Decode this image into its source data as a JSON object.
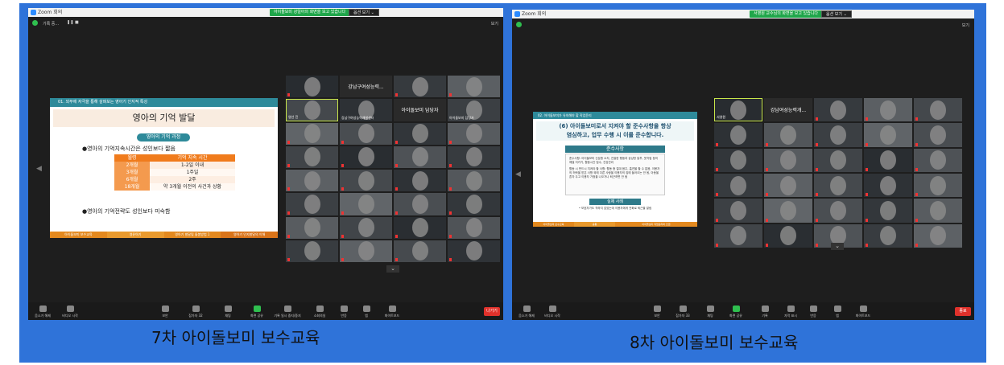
{
  "left": {
    "app_title": "Zoom 회의",
    "banner": "아이돌보미 강일아의 화면을 보고 있습니다",
    "view_options": "옵션 보기 ⌄",
    "recording": "기록 중...",
    "top_right": "보기",
    "slide": {
      "header": "01. 외부에 자극을 통해 살펴보는 영아기 인지적 특성",
      "title": "영아의 기억 발달",
      "pill": "영아의 기억 과정",
      "bullet1": "●영아의 기억지속시간은 성인보다 짧음",
      "table_headers": [
        "월령",
        "기억 지속 시간"
      ],
      "table_rows": [
        [
          "2개월",
          "1-2일 이내"
        ],
        [
          "3개월",
          "1주일"
        ],
        [
          "6개월",
          "2주"
        ],
        [
          "18개월",
          "약 3개월 이전의 사건과 상황"
        ]
      ],
      "bullet2": "●영아의 기억전략도 성인보다 미숙함",
      "footer": [
        "아이돌보미 보수교육",
        "영유아기",
        "영아기 발달및 돌봄방법 1",
        "영아기 인지발달의 이해"
      ]
    },
    "tiles": [
      {
        "type": "video"
      },
      {
        "type": "named",
        "label": "강남구여성능력..."
      },
      {
        "type": "video"
      },
      {
        "type": "video"
      },
      {
        "type": "video",
        "name": "영선 진",
        "speaker": true
      },
      {
        "type": "video",
        "name": "강남구여성능력개발센터"
      },
      {
        "type": "named",
        "label": "아이돌보미 담당자"
      },
      {
        "type": "video",
        "name": "아이돌보미 담당자"
      },
      {
        "type": "video"
      },
      {
        "type": "video"
      },
      {
        "type": "video"
      },
      {
        "type": "video"
      },
      {
        "type": "video"
      },
      {
        "type": "video"
      },
      {
        "type": "video"
      },
      {
        "type": "video"
      },
      {
        "type": "video"
      },
      {
        "type": "video"
      },
      {
        "type": "video"
      },
      {
        "type": "video"
      },
      {
        "type": "video"
      },
      {
        "type": "video"
      },
      {
        "type": "video"
      },
      {
        "type": "video"
      },
      {
        "type": "video"
      },
      {
        "type": "video"
      },
      {
        "type": "video"
      },
      {
        "type": "video"
      },
      {
        "type": "video"
      },
      {
        "type": "video"
      },
      {
        "type": "video"
      },
      {
        "type": "video"
      }
    ],
    "toolbar": [
      {
        "label": "음소거 해제",
        "x": 0
      },
      {
        "label": "비디오 시작",
        "x": 0
      },
      {
        "label": "보안",
        "x": 0
      },
      {
        "label": "참가자 32",
        "x": 0
      },
      {
        "label": "채팅",
        "x": 0
      },
      {
        "label": "화면 공유",
        "x": 0
      },
      {
        "label": "기록 일시 중지/중지",
        "x": 0
      },
      {
        "label": "소회의실",
        "x": 0
      },
      {
        "label": "반응",
        "x": 0
      },
      {
        "label": "앱",
        "x": 0
      },
      {
        "label": "화이트보드",
        "x": 0
      }
    ],
    "end_label": "나가기",
    "caption": "7차 아이돌보미 보수교육"
  },
  "right": {
    "app_title": "Zoom 회의",
    "banner": "서영원 교수님의 화면을 보고 있습니다",
    "view_options": "옵션 보기 ⌄",
    "top_right": "보기",
    "slide": {
      "header": "02. 아이돌보미가 유의해야 할 직업윤리",
      "title_line1": "(6) 아이돌보미로서 지켜야 할 준수사항을 항상",
      "title_line2": "염심하고, 업무 수행 시 이를 준수합니다.",
      "box_title": "준수사항",
      "para1": "준수사항: 아이돌보미 신분증 소지, 친절한 행동과 상냥한 말투, 옷차림 등의 예절 지키기, 활동시간 엄수, 건강관리",
      "para2": "활동 시 반드시 지켜야 할 사항: 활동 중 절대 음주, 흡연을 할 수 없음, 이용자의 허락을 받은 사항 외에 다른 사람을 이용자의 집에 들어오는 안 됨, 아동을 혼자 두고 이용자 가정을 나오거나 퇴근하면 안 됨",
      "case_title": "실제 사례",
      "case_text": "• 보호자가도 착하지 않았는데 이용자에게 전화로 퇴근을 알림",
      "footer": [
        "아이돌보미 보수교육",
        "공통",
        "아이돌보미 직업윤리와 인권"
      ]
    },
    "tiles": [
      {
        "type": "video",
        "name": "서영원",
        "speaker": true
      },
      {
        "type": "named",
        "label": "강남여성능력개..."
      },
      {
        "type": "video"
      },
      {
        "type": "video"
      },
      {
        "type": "video"
      },
      {
        "type": "video"
      },
      {
        "type": "video"
      },
      {
        "type": "video"
      },
      {
        "type": "video"
      },
      {
        "type": "video"
      },
      {
        "type": "video"
      },
      {
        "type": "video"
      },
      {
        "type": "video"
      },
      {
        "type": "video"
      },
      {
        "type": "video"
      },
      {
        "type": "video"
      },
      {
        "type": "video"
      },
      {
        "type": "video"
      },
      {
        "type": "video"
      },
      {
        "type": "video"
      },
      {
        "type": "video"
      },
      {
        "type": "video"
      },
      {
        "type": "video"
      },
      {
        "type": "video"
      },
      {
        "type": "video"
      },
      {
        "type": "video"
      },
      {
        "type": "video"
      },
      {
        "type": "video"
      },
      {
        "type": "video"
      },
      {
        "type": "video"
      }
    ],
    "toolbar": [
      {
        "label": "음소거 해제"
      },
      {
        "label": "비디오 시작"
      },
      {
        "label": "보안"
      },
      {
        "label": "참가자 33"
      },
      {
        "label": "채팅"
      },
      {
        "label": "화면 공유"
      },
      {
        "label": "기록"
      },
      {
        "label": "자막 표시"
      },
      {
        "label": "반응"
      },
      {
        "label": "앱"
      },
      {
        "label": "화이트보드"
      }
    ],
    "end_label": "종료",
    "caption": "8차 아이돌보미 보수교육"
  },
  "colors": {
    "frame": "#2f73d9",
    "zoom_bg": "#1e1e1e",
    "share_green": "#1fa64a",
    "slide_teal": "#2e8a9a",
    "table_orange": "#f07b1c",
    "end_red": "#e0312b",
    "speaker_border": "#c8e64a"
  }
}
